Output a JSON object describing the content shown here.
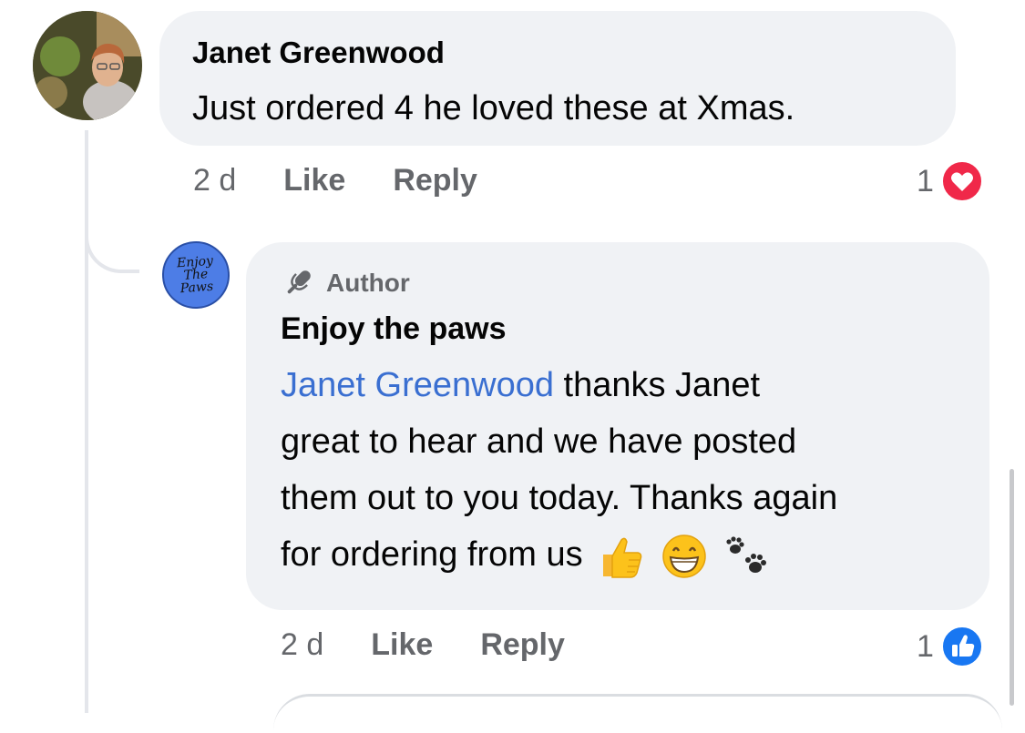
{
  "comment": {
    "author": "Janet Greenwood",
    "text": "Just ordered 4 he loved these at Xmas.",
    "time": "2 d",
    "like_label": "Like",
    "reply_label": "Reply",
    "reaction_count": "1",
    "reaction_icon": "love-heart-icon",
    "reaction_color": "#f02849"
  },
  "reply": {
    "avatar_text": [
      "Enjoy",
      "The",
      "Paws"
    ],
    "badge": "Author",
    "author": "Enjoy the paws",
    "mention": "Janet Greenwood",
    "text_lines": [
      " thanks Janet",
      "great to hear and we have posted",
      "them out to you today. Thanks again",
      "for ordering from us"
    ],
    "emojis": [
      "thumbs-up-icon",
      "grinning-face-icon",
      "paw-prints-icon"
    ],
    "time": "2 d",
    "like_label": "Like",
    "reply_label": "Reply",
    "reaction_count": "1",
    "reaction_icon": "like-thumb-icon",
    "reaction_color": "#1877f2"
  },
  "colors": {
    "bubble": "#f0f2f5",
    "secondary_text": "#65676b",
    "mention": "#3a6fd1"
  }
}
